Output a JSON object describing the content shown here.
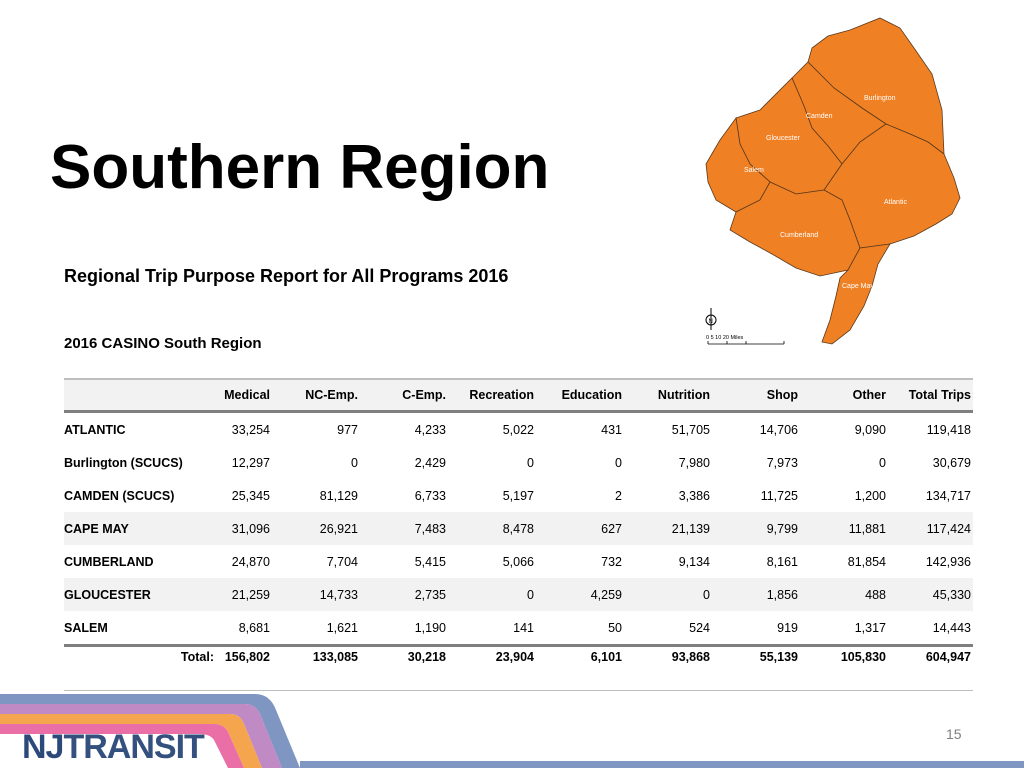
{
  "page": {
    "title": "Southern Region",
    "subtitle": "Regional Trip Purpose Report for All Programs 2016",
    "section": "2016 CASINO South Region",
    "page_number": "15"
  },
  "map": {
    "counties": [
      "Burlington",
      "Camden",
      "Gloucester",
      "Salem",
      "Atlantic",
      "Cumberland",
      "Cape May"
    ],
    "scale_label": "0  5  10        20 Miles",
    "fill_color": "#f08024"
  },
  "table": {
    "headers": [
      "",
      "Medical",
      "NC-Emp.",
      "C-Emp.",
      "Recreation",
      "Education",
      "Nutrition",
      "Shop",
      "Other",
      "Total Trips"
    ],
    "rows": [
      [
        "ATLANTIC",
        "33,254",
        "977",
        "4,233",
        "5,022",
        "431",
        "51,705",
        "14,706",
        "9,090",
        "119,418"
      ],
      [
        "Burlington (SCUCS)",
        "12,297",
        "0",
        "2,429",
        "0",
        "0",
        "7,980",
        "7,973",
        "0",
        "30,679"
      ],
      [
        "CAMDEN (SCUCS)",
        "25,345",
        "81,129",
        "6,733",
        "5,197",
        "2",
        "3,386",
        "11,725",
        "1,200",
        "134,717"
      ],
      [
        "CAPE MAY",
        "31,096",
        "26,921",
        "7,483",
        "8,478",
        "627",
        "21,139",
        "9,799",
        "11,881",
        "117,424"
      ],
      [
        "CUMBERLAND",
        "24,870",
        "7,704",
        "5,415",
        "5,066",
        "732",
        "9,134",
        "8,161",
        "81,854",
        "142,936"
      ],
      [
        "GLOUCESTER",
        "21,259",
        "14,733",
        "2,735",
        "0",
        "4,259",
        "0",
        "1,856",
        "488",
        "45,330"
      ],
      [
        "SALEM",
        "8,681",
        "1,621",
        "1,190",
        "141",
        "50",
        "524",
        "919",
        "1,317",
        "14,443"
      ]
    ],
    "total": [
      "Total:",
      "156,802",
      "133,085",
      "30,218",
      "23,904",
      "6,101",
      "93,868",
      "55,139",
      "105,830",
      "604,947"
    ]
  },
  "logo": {
    "nj": "NJ",
    "transit": "TRANSIT"
  },
  "colors": {
    "stripe_blue": "#7f95c2",
    "stripe_purple": "#c08ac4",
    "stripe_orange": "#f6a54f",
    "stripe_pink": "#e96fa6"
  }
}
